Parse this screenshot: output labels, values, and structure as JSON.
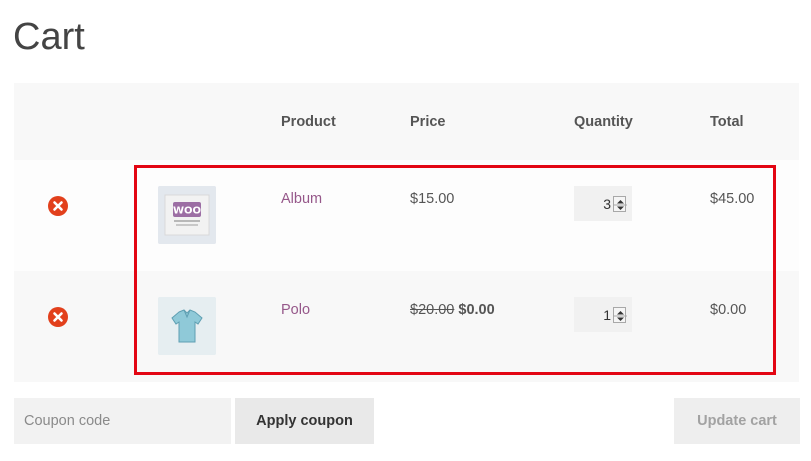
{
  "page": {
    "title": "Cart"
  },
  "cart": {
    "columns": {
      "product": "Product",
      "price": "Price",
      "quantity": "Quantity",
      "total": "Total"
    },
    "items": [
      {
        "name": "Album",
        "price": "$15.00",
        "regular_price": "",
        "sale_price": "",
        "quantity": "3",
        "total": "$45.00",
        "thumb_icon": "album-woo-thumbnail-icon"
      },
      {
        "name": "Polo",
        "price": "",
        "regular_price": "$20.00",
        "sale_price": "$0.00",
        "quantity": "1",
        "total": "$0.00",
        "thumb_icon": "polo-shirt-thumbnail-icon"
      }
    ]
  },
  "coupon": {
    "placeholder": "Coupon code",
    "apply_label": "Apply coupon"
  },
  "update": {
    "label": "Update cart"
  },
  "colors": {
    "link": "#96588a",
    "remove": "#e2401c",
    "highlight": "#e30613",
    "header_bg": "#f8f8f8"
  }
}
